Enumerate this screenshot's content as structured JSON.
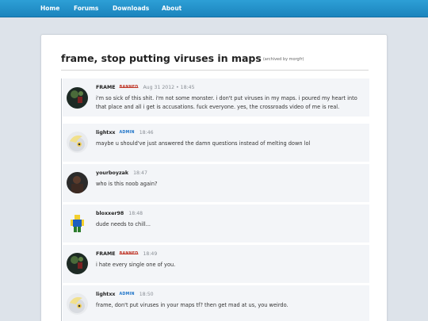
{
  "nav": {
    "home": "Home",
    "forums": "Forums",
    "downloads": "Downloads",
    "about": "About"
  },
  "thread": {
    "title": "frame, stop putting viruses in maps",
    "archived_note": "(archived by morgfr)"
  },
  "posts": [
    {
      "user": "FRAME",
      "badge": "BANNED",
      "time": "Aug 31 2012 • 18:45",
      "text": "i'm so sick of this shit. i'm not some monster. i don't put viruses in my maps. i poured my heart into that place and all i get is accusations. fuck everyone. yes, the crossroads video of me is real."
    },
    {
      "user": "lightxx",
      "badge": "ADMIN",
      "time": "18:46",
      "text": "maybe u should've just answered the damn questions instead of melting down lol"
    },
    {
      "user": "yourboyzak",
      "badge": "",
      "time": "18:47",
      "text": "who is this noob again?"
    },
    {
      "user": "bloxxer98",
      "badge": "",
      "time": "18:48",
      "text": "dude needs to chill..."
    },
    {
      "user": "FRAME",
      "badge": "BANNED",
      "time": "18:49",
      "text": "i hate every single one of you."
    },
    {
      "user": "lightxx",
      "badge": "ADMIN",
      "time": "18:50",
      "text": "frame, don't put viruses in your maps tf? then get mad at us, you weirdo."
    }
  ],
  "colors": {
    "nav": "#1b84bd",
    "banned": "#c0392b",
    "admin": "#2176c9"
  }
}
